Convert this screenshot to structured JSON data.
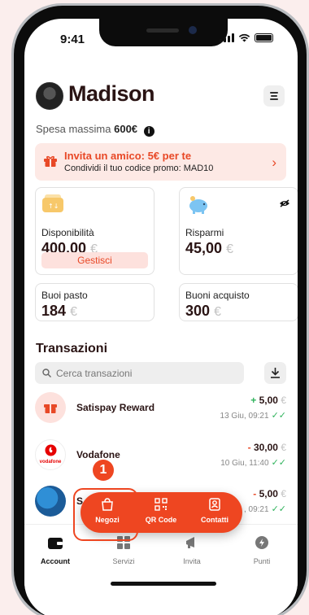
{
  "status_bar": {
    "time": "9:41"
  },
  "profile": {
    "name": "Madison",
    "spend_label": "Spesa massima",
    "spend_value": "600€"
  },
  "promo": {
    "title": "Invita un amico: 5€ per te",
    "subtitle": "Condividi il tuo codice promo: MAD10"
  },
  "cards": {
    "disponibilita": {
      "label": "Disponibilità",
      "value": "400,00",
      "currency": "€",
      "button": "Gestisci"
    },
    "risparmi": {
      "label": "Risparmi",
      "value": "45,00",
      "currency": "€"
    },
    "buoni_pasto": {
      "label": "Buoi pasto",
      "value": "184",
      "currency": "€"
    },
    "buoni_acquisto": {
      "label": "Buoni acquisto",
      "value": "300",
      "currency": "€"
    }
  },
  "transactions": {
    "title": "Transazioni",
    "search_placeholder": "Cerca transazioni",
    "items": [
      {
        "name": "Satispay Reward",
        "sign": "+",
        "amount": "5,00",
        "currency": "€",
        "date": "13 Giu, 09:21"
      },
      {
        "name": "Vodafone",
        "sign": "-",
        "amount": "30,00",
        "currency": "€",
        "date": "10 Giu, 11:40"
      },
      {
        "name": "S",
        "sign": "-",
        "amount": "5,00",
        "currency": "€",
        "date": ", 09:21"
      }
    ],
    "vodafone_logo_text": "vodafone"
  },
  "quick_actions": [
    {
      "label": "Negozi"
    },
    {
      "label": "QR Code"
    },
    {
      "label": "Contatti"
    }
  ],
  "step_badge": "1",
  "tabs": [
    {
      "label": "Account"
    },
    {
      "label": "Servizi"
    },
    {
      "label": "Invita"
    },
    {
      "label": "Punti"
    }
  ],
  "colors": {
    "accent": "#ee4621",
    "background": "#fbeeed",
    "positive": "#30b35c"
  }
}
